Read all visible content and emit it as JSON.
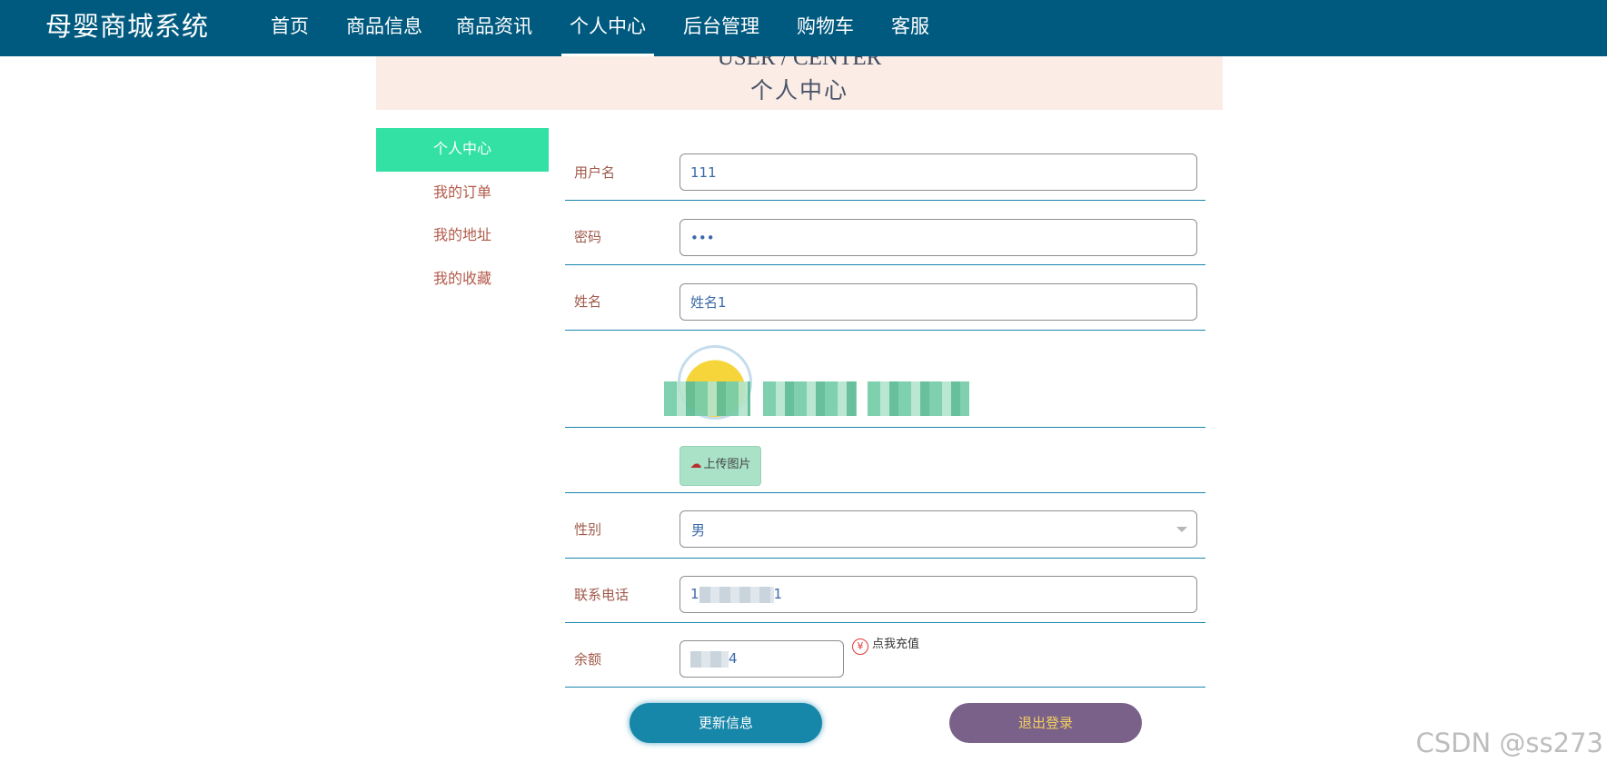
{
  "header": {
    "brand": "母婴商城系统",
    "nav": [
      {
        "label": "首页"
      },
      {
        "label": "商品信息"
      },
      {
        "label": "商品资讯"
      },
      {
        "label": "个人中心",
        "active": true
      },
      {
        "label": "后台管理"
      },
      {
        "label": "购物车"
      },
      {
        "label": "客服"
      }
    ]
  },
  "banner": {
    "en": "USER / CENTER",
    "zh": "个人中心"
  },
  "sidebar": {
    "items": [
      {
        "label": "个人中心",
        "active": true
      },
      {
        "label": "我的订单"
      },
      {
        "label": "我的地址"
      },
      {
        "label": "我的收藏"
      }
    ]
  },
  "form": {
    "username": {
      "label": "用户名",
      "value": "111"
    },
    "password": {
      "label": "密码",
      "value": "•••"
    },
    "name": {
      "label": "姓名",
      "value": "姓名1"
    },
    "upload": {
      "label": "上传图片"
    },
    "gender": {
      "label": "性别",
      "value": "男"
    },
    "phone": {
      "label": "联系电话",
      "value_prefix": "1",
      "value_suffix": "1"
    },
    "balance": {
      "label": "余额",
      "value_suffix": "4"
    },
    "recharge": {
      "label": "点我充值"
    }
  },
  "actions": {
    "update": "更新信息",
    "logout": "退出登录"
  },
  "watermark": "CSDN @ss273",
  "colors": {
    "nav_bg": "#005a7f",
    "banner_bg": "#fbede6",
    "active_side": "#33e1a5",
    "row_border": "#1a86ad",
    "update_btn": "#1686a9",
    "logout_btn": "#7a6189"
  }
}
